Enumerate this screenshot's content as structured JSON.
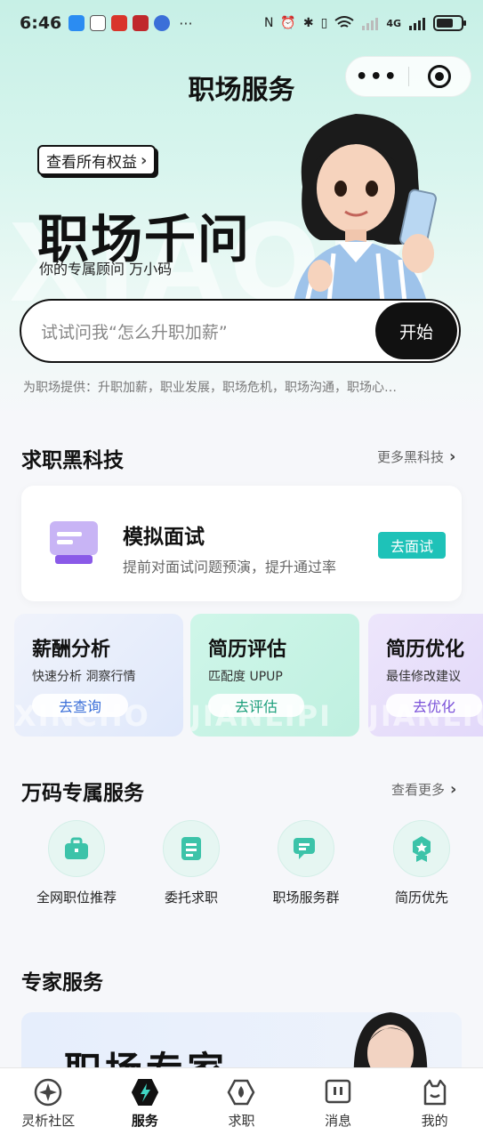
{
  "status_bar": {
    "time": "6:46",
    "more": "···",
    "signal_label": "4G",
    "battery_level": 0.7
  },
  "titlebar": {
    "title": "职场服务",
    "menu_label": "•••"
  },
  "hero": {
    "benefits_button": "查看所有权益",
    "title": "职场千问",
    "subtitle": "你的专属顾问 万小码",
    "watermark": "XIAOM"
  },
  "search": {
    "placeholder": "试试问我“怎么升职加薪”",
    "button": "开始",
    "provides": "为职场提供：升职加薪，职业发展，职场危机，职场沟通，职场心…"
  },
  "tech_section": {
    "title": "求职黑科技",
    "more": "更多黑科技",
    "interview": {
      "title": "模拟面试",
      "desc": "提前对面试问题预演，提升通过率",
      "button": "去面试"
    },
    "tools": [
      {
        "title": "薪酬分析",
        "desc": "快速分析 洞察行情",
        "button": "去查询",
        "watermark": "XINCHO"
      },
      {
        "title": "简历评估",
        "desc": "匹配度 UPUP",
        "button": "去评估",
        "watermark": "JIANLIPI"
      },
      {
        "title": "简历优化",
        "desc": "最佳修改建议",
        "button": "去优化",
        "watermark": "JIANLIU"
      }
    ]
  },
  "services_section": {
    "title": "万码专属服务",
    "more": "查看更多",
    "items": [
      {
        "label": "全网职位推荐",
        "icon": "briefcase-icon"
      },
      {
        "label": "委托求职",
        "icon": "document-icon"
      },
      {
        "label": "职场服务群",
        "icon": "chat-icon"
      },
      {
        "label": "简历优先",
        "icon": "badge-icon"
      }
    ]
  },
  "expert_section": {
    "title": "专家服务",
    "banner_text": "职场专家"
  },
  "tabbar": {
    "tabs": [
      {
        "label": "灵析社区",
        "icon": "star-compass-icon"
      },
      {
        "label": "服务",
        "icon": "lightning-icon"
      },
      {
        "label": "求职",
        "icon": "drop-icon"
      },
      {
        "label": "消息",
        "icon": "message-icon"
      },
      {
        "label": "我的",
        "icon": "cat-profile-icon"
      }
    ],
    "active": "服务"
  },
  "colors": {
    "accent": "#1ec2b8",
    "hero_bg": "#c7f0e6",
    "dark": "#111111"
  }
}
